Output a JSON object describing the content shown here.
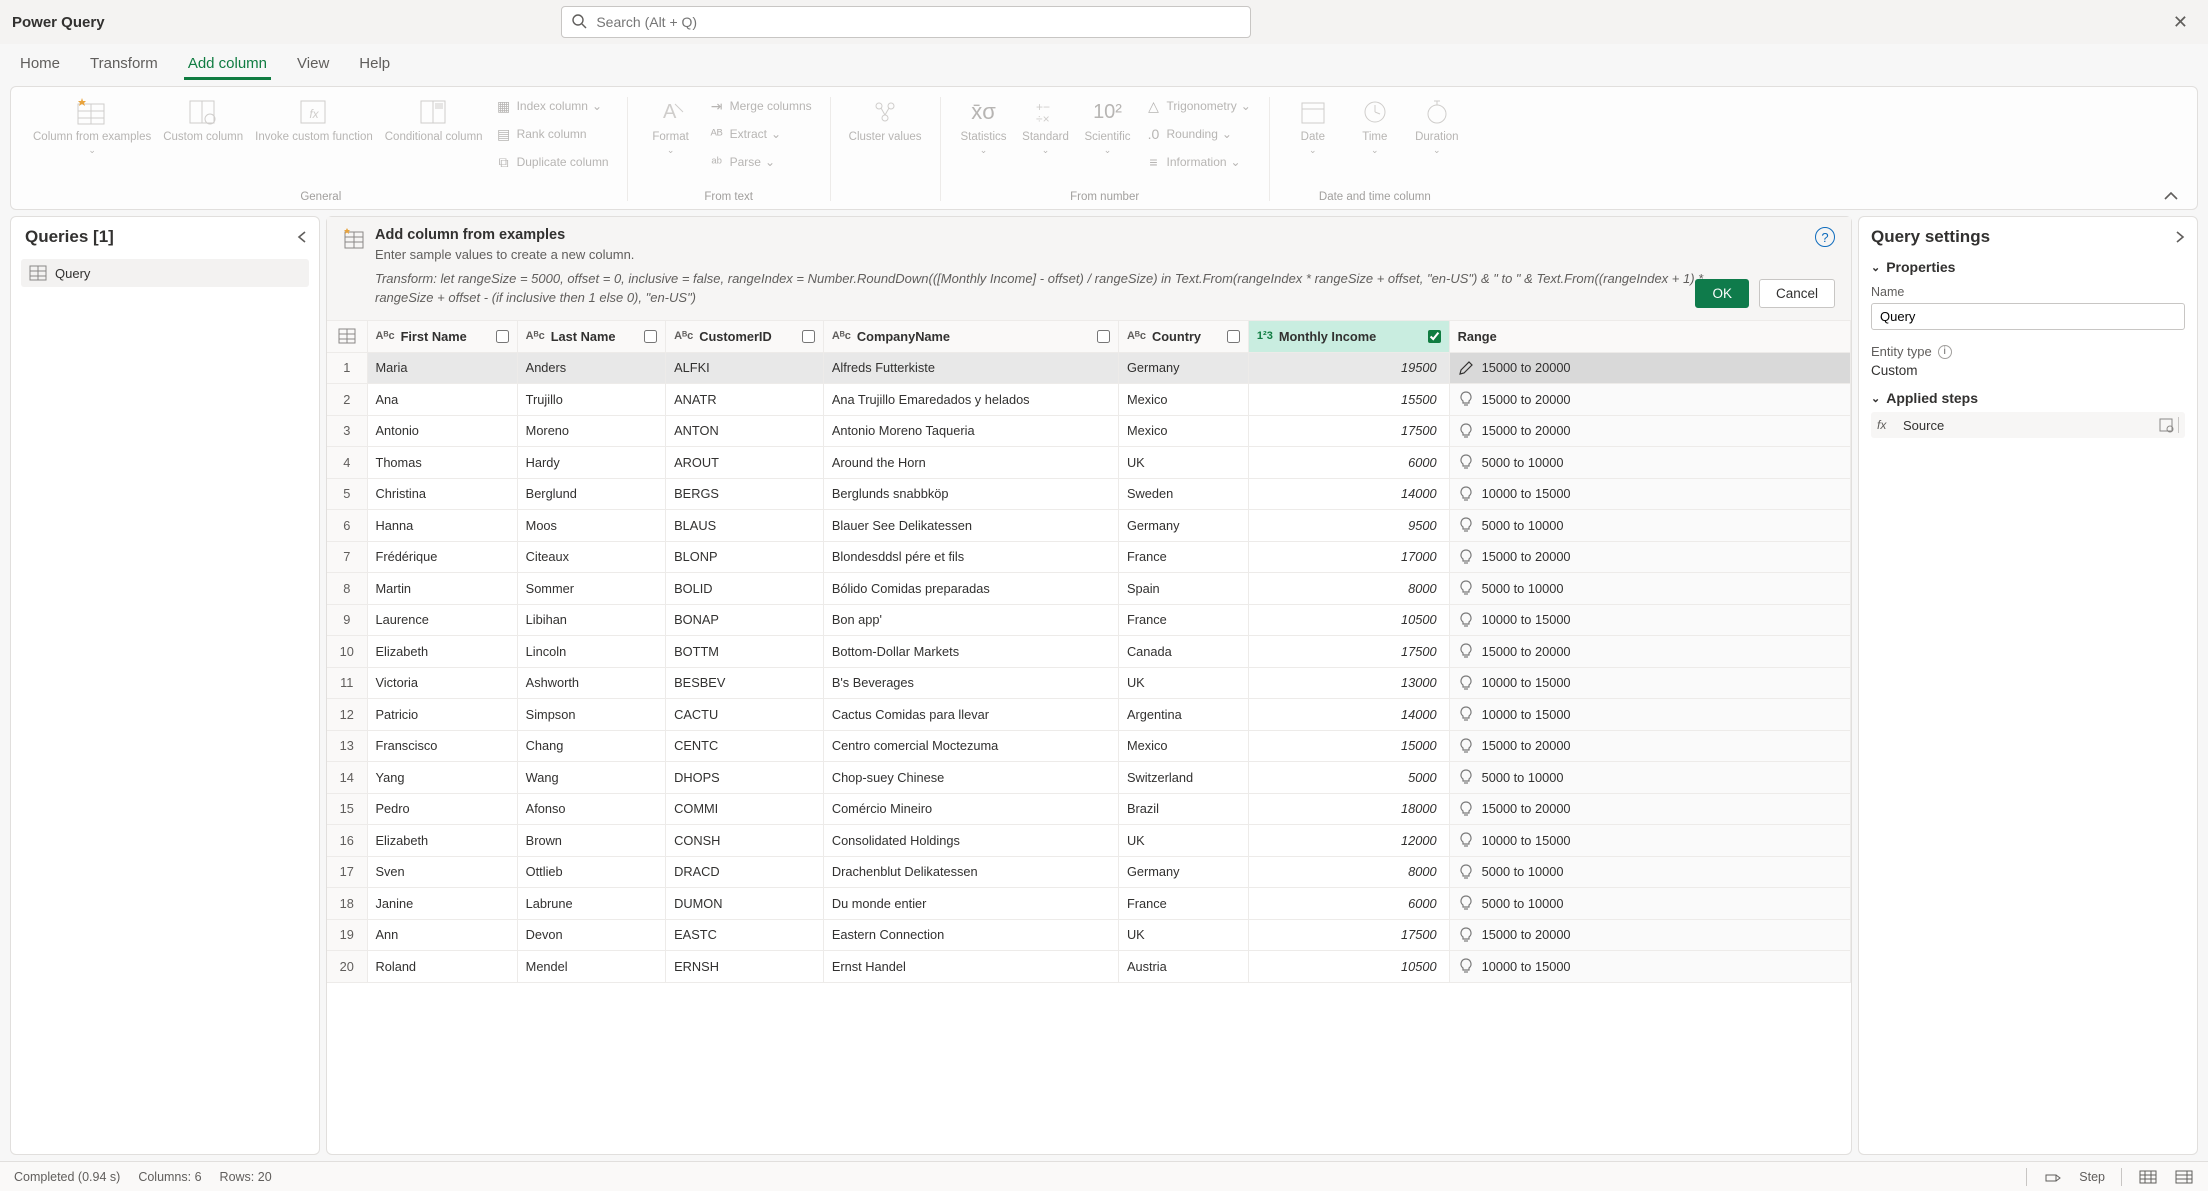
{
  "title": "Power Query",
  "search_placeholder": "Search (Alt + Q)",
  "tabs": [
    "Home",
    "Transform",
    "Add column",
    "View",
    "Help"
  ],
  "active_tab": 2,
  "ribbon": {
    "general": {
      "label": "General",
      "col_from_examples": "Column from examples",
      "custom_column": "Custom column",
      "invoke_custom": "Invoke custom function",
      "conditional": "Conditional column",
      "index": "Index column",
      "rank": "Rank column",
      "duplicate": "Duplicate column"
    },
    "from_text": {
      "label": "From text",
      "format": "Format",
      "merge": "Merge columns",
      "extract": "Extract",
      "parse": "Parse"
    },
    "cluster": "Cluster values",
    "from_number": {
      "label": "From number",
      "statistics": "Statistics",
      "standard": "Standard",
      "scientific": "Scientific",
      "trig": "Trigonometry",
      "rounding": "Rounding",
      "info": "Information"
    },
    "datetime": {
      "label": "Date and time column",
      "date": "Date",
      "time": "Time",
      "duration": "Duration"
    }
  },
  "queries": {
    "header": "Queries [1]",
    "items": [
      "Query"
    ]
  },
  "banner": {
    "title": "Add column from examples",
    "subtitle": "Enter sample values to create a new column.",
    "transform": "Transform: let rangeSize = 5000, offset = 0, inclusive = false, rangeIndex = Number.RoundDown(([Monthly Income] - offset) / rangeSize) in Text.From(rangeIndex * rangeSize + offset, \"en-US\") & \" to \" & Text.From((rangeIndex + 1) * rangeSize + offset - (if inclusive then 1 else 0), \"en-US\")",
    "ok": "OK",
    "cancel": "Cancel"
  },
  "columns": {
    "first_name": "First Name",
    "last_name": "Last Name",
    "customer_id": "CustomerID",
    "company": "CompanyName",
    "country": "Country",
    "monthly_income": "Monthly Income",
    "range": "Range"
  },
  "rows": [
    {
      "n": 1,
      "first": "Maria",
      "last": "Anders",
      "cid": "ALFKI",
      "company": "Alfreds Futterkiste",
      "country": "Germany",
      "mi": "19500",
      "range": "15000 to 20000",
      "sel": true
    },
    {
      "n": 2,
      "first": "Ana",
      "last": "Trujillo",
      "cid": "ANATR",
      "company": "Ana Trujillo Emaredados y helados",
      "country": "Mexico",
      "mi": "15500",
      "range": "15000 to 20000"
    },
    {
      "n": 3,
      "first": "Antonio",
      "last": "Moreno",
      "cid": "ANTON",
      "company": "Antonio Moreno Taqueria",
      "country": "Mexico",
      "mi": "17500",
      "range": "15000 to 20000"
    },
    {
      "n": 4,
      "first": "Thomas",
      "last": "Hardy",
      "cid": "AROUT",
      "company": "Around the Horn",
      "country": "UK",
      "mi": "6000",
      "range": "5000 to 10000"
    },
    {
      "n": 5,
      "first": "Christina",
      "last": "Berglund",
      "cid": "BERGS",
      "company": "Berglunds snabbköp",
      "country": "Sweden",
      "mi": "14000",
      "range": "10000 to 15000"
    },
    {
      "n": 6,
      "first": "Hanna",
      "last": "Moos",
      "cid": "BLAUS",
      "company": "Blauer See Delikatessen",
      "country": "Germany",
      "mi": "9500",
      "range": "5000 to 10000"
    },
    {
      "n": 7,
      "first": "Frédérique",
      "last": "Citeaux",
      "cid": "BLONP",
      "company": "Blondesddsl pére et fils",
      "country": "France",
      "mi": "17000",
      "range": "15000 to 20000"
    },
    {
      "n": 8,
      "first": "Martin",
      "last": "Sommer",
      "cid": "BOLID",
      "company": "Bólido Comidas preparadas",
      "country": "Spain",
      "mi": "8000",
      "range": "5000 to 10000"
    },
    {
      "n": 9,
      "first": "Laurence",
      "last": "Libihan",
      "cid": "BONAP",
      "company": "Bon app'",
      "country": "France",
      "mi": "10500",
      "range": "10000 to 15000"
    },
    {
      "n": 10,
      "first": "Elizabeth",
      "last": "Lincoln",
      "cid": "BOTTM",
      "company": "Bottom-Dollar Markets",
      "country": "Canada",
      "mi": "17500",
      "range": "15000 to 20000"
    },
    {
      "n": 11,
      "first": "Victoria",
      "last": "Ashworth",
      "cid": "BESBEV",
      "company": "B's Beverages",
      "country": "UK",
      "mi": "13000",
      "range": "10000 to 15000"
    },
    {
      "n": 12,
      "first": "Patricio",
      "last": "Simpson",
      "cid": "CACTU",
      "company": "Cactus Comidas para llevar",
      "country": "Argentina",
      "mi": "14000",
      "range": "10000 to 15000"
    },
    {
      "n": 13,
      "first": "Franscisco",
      "last": "Chang",
      "cid": "CENTC",
      "company": "Centro comercial Moctezuma",
      "country": "Mexico",
      "mi": "15000",
      "range": "15000 to 20000"
    },
    {
      "n": 14,
      "first": "Yang",
      "last": "Wang",
      "cid": "DHOPS",
      "company": "Chop-suey Chinese",
      "country": "Switzerland",
      "mi": "5000",
      "range": "5000 to 10000"
    },
    {
      "n": 15,
      "first": "Pedro",
      "last": "Afonso",
      "cid": "COMMI",
      "company": "Comércio Mineiro",
      "country": "Brazil",
      "mi": "18000",
      "range": "15000 to 20000"
    },
    {
      "n": 16,
      "first": "Elizabeth",
      "last": "Brown",
      "cid": "CONSH",
      "company": "Consolidated Holdings",
      "country": "UK",
      "mi": "12000",
      "range": "10000 to 15000"
    },
    {
      "n": 17,
      "first": "Sven",
      "last": "Ottlieb",
      "cid": "DRACD",
      "company": "Drachenblut Delikatessen",
      "country": "Germany",
      "mi": "8000",
      "range": "5000 to 10000"
    },
    {
      "n": 18,
      "first": "Janine",
      "last": "Labrune",
      "cid": "DUMON",
      "company": "Du monde entier",
      "country": "France",
      "mi": "6000",
      "range": "5000 to 10000"
    },
    {
      "n": 19,
      "first": "Ann",
      "last": "Devon",
      "cid": "EASTC",
      "company": "Eastern Connection",
      "country": "UK",
      "mi": "17500",
      "range": "15000 to 20000"
    },
    {
      "n": 20,
      "first": "Roland",
      "last": "Mendel",
      "cid": "ERNSH",
      "company": "Ernst Handel",
      "country": "Austria",
      "mi": "10500",
      "range": "10000 to 15000"
    }
  ],
  "settings": {
    "header": "Query settings",
    "properties": "Properties",
    "name_label": "Name",
    "name_value": "Query",
    "entity_type_label": "Entity type",
    "entity_type_value": "Custom",
    "applied_steps": "Applied steps",
    "steps": [
      "Source"
    ]
  },
  "status": {
    "completed": "Completed (0.94 s)",
    "columns": "Columns: 6",
    "rows": "Rows: 20",
    "step": "Step"
  }
}
